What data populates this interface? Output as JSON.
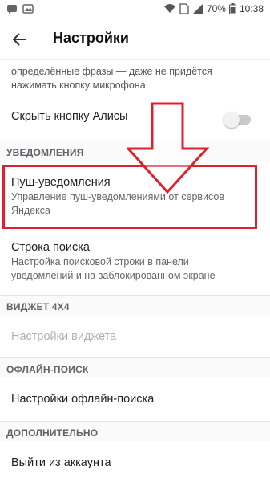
{
  "status_bar": {
    "battery": "70%",
    "time": "10:38"
  },
  "app_bar": {
    "title": "Настройки"
  },
  "partial_item": {
    "text": "определённые фразы — даже не придётся нажимать кнопку микрофона"
  },
  "items": {
    "hide_alice": {
      "label": "Скрыть кнопку Алисы",
      "toggle_on": false
    },
    "push": {
      "title": "Пуш-уведомления",
      "subtitle": "Управление пуш-уведомлениями от сервисов Яндекса"
    },
    "search_bar": {
      "title": "Строка поиска",
      "subtitle": "Настройка поисковой строки в панели уведомлений и на заблокированном экране"
    },
    "widget_settings": {
      "title": "Настройки виджета"
    },
    "offline_settings": {
      "title": "Настройки офлайн-поиска"
    },
    "logout": {
      "title": "Выйти из аккаунта"
    }
  },
  "sections": {
    "notifications": "УВЕДОМЛЕНИЯ",
    "widget": "ВИДЖЕТ 4X4",
    "offline": "ОФЛАЙН-ПОИСК",
    "additional": "ДОПОЛНИТЕЛЬНО"
  },
  "colors": {
    "highlight": "#e0202e",
    "toggle_track": "#c9c9c9"
  }
}
